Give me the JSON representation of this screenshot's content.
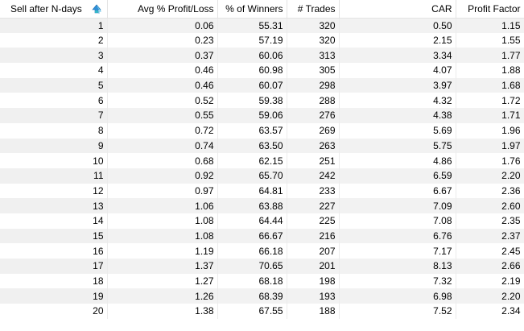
{
  "table": {
    "columns": [
      "Sell after N-days",
      "Avg % Profit/Loss",
      "% of Winners",
      "# Trades",
      "CAR",
      "Profit Factor"
    ],
    "sort_icon": "sort-arrow-icon",
    "rows": [
      [
        "1",
        "0.06",
        "55.31",
        "320",
        "0.50",
        "1.15"
      ],
      [
        "2",
        "0.23",
        "57.19",
        "320",
        "2.15",
        "1.55"
      ],
      [
        "3",
        "0.37",
        "60.06",
        "313",
        "3.34",
        "1.77"
      ],
      [
        "4",
        "0.46",
        "60.98",
        "305",
        "4.07",
        "1.88"
      ],
      [
        "5",
        "0.46",
        "60.07",
        "298",
        "3.97",
        "1.68"
      ],
      [
        "6",
        "0.52",
        "59.38",
        "288",
        "4.32",
        "1.72"
      ],
      [
        "7",
        "0.55",
        "59.06",
        "276",
        "4.38",
        "1.71"
      ],
      [
        "8",
        "0.72",
        "63.57",
        "269",
        "5.69",
        "1.96"
      ],
      [
        "9",
        "0.74",
        "63.50",
        "263",
        "5.75",
        "1.97"
      ],
      [
        "10",
        "0.68",
        "62.15",
        "251",
        "4.86",
        "1.76"
      ],
      [
        "11",
        "0.92",
        "65.70",
        "242",
        "6.59",
        "2.20"
      ],
      [
        "12",
        "0.97",
        "64.81",
        "233",
        "6.67",
        "2.36"
      ],
      [
        "13",
        "1.06",
        "63.88",
        "227",
        "7.09",
        "2.60"
      ],
      [
        "14",
        "1.08",
        "64.44",
        "225",
        "7.08",
        "2.35"
      ],
      [
        "15",
        "1.08",
        "66.67",
        "216",
        "6.76",
        "2.37"
      ],
      [
        "16",
        "1.19",
        "66.18",
        "207",
        "7.17",
        "2.45"
      ],
      [
        "17",
        "1.37",
        "70.65",
        "201",
        "8.13",
        "2.66"
      ],
      [
        "18",
        "1.27",
        "68.18",
        "198",
        "7.32",
        "2.19"
      ],
      [
        "19",
        "1.26",
        "68.39",
        "193",
        "6.98",
        "2.20"
      ],
      [
        "20",
        "1.38",
        "67.55",
        "188",
        "7.52",
        "2.34"
      ]
    ]
  },
  "colors": {
    "row_alt": "#f2f2f2",
    "row": "#ffffff",
    "grid_line": "#e3e3e3",
    "sort_icon_blue": "#2f8fd8",
    "sort_icon_teal": "#35b6c8"
  }
}
